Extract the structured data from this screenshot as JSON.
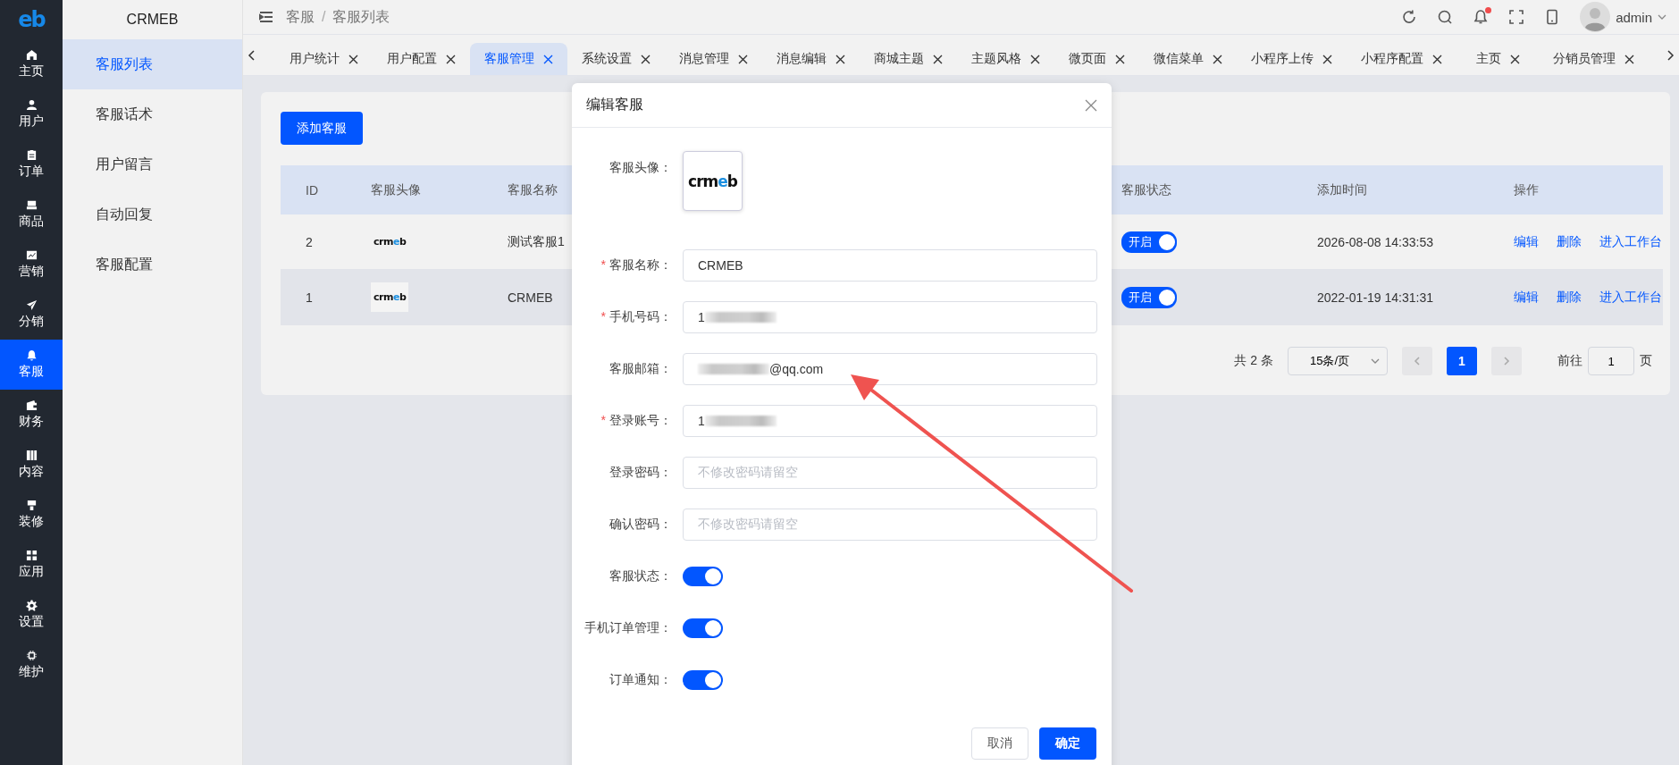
{
  "logo": {
    "text": "eb"
  },
  "nav": [
    {
      "label": "主页",
      "selected": false
    },
    {
      "label": "用户",
      "selected": false
    },
    {
      "label": "订单",
      "selected": false
    },
    {
      "label": "商品",
      "selected": false
    },
    {
      "label": "营销",
      "selected": false
    },
    {
      "label": "分销",
      "selected": false
    },
    {
      "label": "客服",
      "selected": true
    },
    {
      "label": "财务",
      "selected": false
    },
    {
      "label": "内容",
      "selected": false
    },
    {
      "label": "装修",
      "selected": false
    },
    {
      "label": "应用",
      "selected": false
    },
    {
      "label": "设置",
      "selected": false
    },
    {
      "label": "维护",
      "selected": false
    }
  ],
  "subnav": {
    "title": "CRMEB",
    "items": [
      {
        "label": "客服列表",
        "selected": true
      },
      {
        "label": "客服话术",
        "selected": false
      },
      {
        "label": "用户留言",
        "selected": false
      },
      {
        "label": "自动回复",
        "selected": false
      },
      {
        "label": "客服配置",
        "selected": false
      }
    ]
  },
  "header": {
    "breadcrumb": [
      "客服",
      "客服列表"
    ],
    "breadcrumb_separator": "/",
    "unread": true,
    "user": "admin"
  },
  "tabs": [
    {
      "label": "用户统计",
      "selected": false
    },
    {
      "label": "用户配置",
      "selected": false
    },
    {
      "label": "客服管理",
      "selected": true
    },
    {
      "label": "系统设置",
      "selected": false
    },
    {
      "label": "消息管理",
      "selected": false
    },
    {
      "label": "消息编辑",
      "selected": false
    },
    {
      "label": "商城主题",
      "selected": false
    },
    {
      "label": "主题风格",
      "selected": false
    },
    {
      "label": "微页面",
      "selected": false
    },
    {
      "label": "微信菜单",
      "selected": false
    },
    {
      "label": "小程序上传",
      "selected": false
    },
    {
      "label": "小程序配置",
      "selected": false
    },
    {
      "label": "主页",
      "selected": false
    },
    {
      "label": "分销员管理",
      "selected": false
    }
  ],
  "content": {
    "add_button": "添加客服",
    "table": {
      "columns": [
        "ID",
        "客服头像",
        "客服名称",
        "客服状态",
        "添加时间",
        "操作"
      ],
      "rows": [
        {
          "id": "2",
          "avatar": "crmeb",
          "name": "测试客服1",
          "status": {
            "label": "开启",
            "on": true
          },
          "time": "2026-08-08 14:33:53",
          "actions": [
            "编辑",
            "删除",
            "进入工作台"
          ],
          "hovered": false
        },
        {
          "id": "1",
          "avatar": "crmeb",
          "name": "CRMEB",
          "status": {
            "label": "开启",
            "on": true
          },
          "time": "2022-01-19 14:31:31",
          "actions": [
            "编辑",
            "删除",
            "进入工作台"
          ],
          "hovered": true
        }
      ]
    },
    "pagination": {
      "total": "共 2 条",
      "page_size": "15条/页",
      "pages": [
        {
          "label": "1",
          "selected": true
        }
      ],
      "goto_label": "前往",
      "goto_value": "1",
      "page_suffix": "页"
    }
  },
  "dialog": {
    "title": "编辑客服",
    "required_mark": "*",
    "fields": [
      {
        "kind": "avatar",
        "label": "客服头像：",
        "required": false,
        "logo": "crmeb"
      },
      {
        "kind": "input",
        "label": "客服名称：",
        "required": true,
        "value": "CRMEB",
        "blur_before": false,
        "blur_after": false
      },
      {
        "kind": "input",
        "label": "手机号码：",
        "required": true,
        "value": "1",
        "blur_before": false,
        "blur_after": true
      },
      {
        "kind": "input",
        "label": "客服邮箱：",
        "required": false,
        "value": "@qq.com",
        "blur_before": true,
        "blur_after": false
      },
      {
        "kind": "input",
        "label": "登录账号：",
        "required": true,
        "value": "1",
        "blur_before": false,
        "blur_after": true
      },
      {
        "kind": "input",
        "label": "登录密码：",
        "required": false,
        "placeholder": "不修改密码请留空",
        "blur_before": false,
        "blur_after": false
      },
      {
        "kind": "input",
        "label": "确认密码：",
        "required": false,
        "placeholder": "不修改密码请留空",
        "blur_before": false,
        "blur_after": false
      },
      {
        "kind": "switch",
        "label": "客服状态：",
        "required": false,
        "on": true
      },
      {
        "kind": "switch",
        "label": "手机订单管理：",
        "required": false,
        "on": true
      },
      {
        "kind": "switch",
        "label": "订单通知：",
        "required": false,
        "on": true
      }
    ],
    "buttons": [
      {
        "label": "取消",
        "kind": "default"
      },
      {
        "label": "确定",
        "kind": "primary"
      }
    ]
  },
  "annotation": {
    "kind": "arrow"
  }
}
